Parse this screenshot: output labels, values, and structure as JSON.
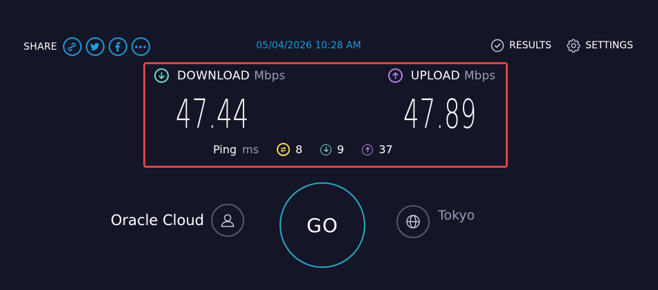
{
  "top": {
    "share_label": "SHARE",
    "share_icons": [
      "link-icon",
      "twitter-icon",
      "facebook-icon",
      "more-icon"
    ],
    "timestamp": "05/04/2026 10:28 AM",
    "results_label": "RESULTS",
    "settings_label": "SETTINGS"
  },
  "download": {
    "label": "DOWNLOAD",
    "unit": "Mbps",
    "value": "47.44"
  },
  "upload": {
    "label": "UPLOAD",
    "unit": "Mbps",
    "value": "47.89"
  },
  "ping": {
    "label": "Ping",
    "unit": "ms",
    "idle": "8",
    "download": "9",
    "upload": "37"
  },
  "isp": {
    "name": "Oracle Cloud"
  },
  "go_label": "GO",
  "server": {
    "name": "Tokyo"
  },
  "colors": {
    "background": "#141526",
    "accent_blue": "#1e9cdc",
    "download_teal": "#6fe0ce",
    "upload_purple": "#b583e8",
    "jitter_yellow": "#f2d85b",
    "highlight_red": "#e0424a"
  }
}
